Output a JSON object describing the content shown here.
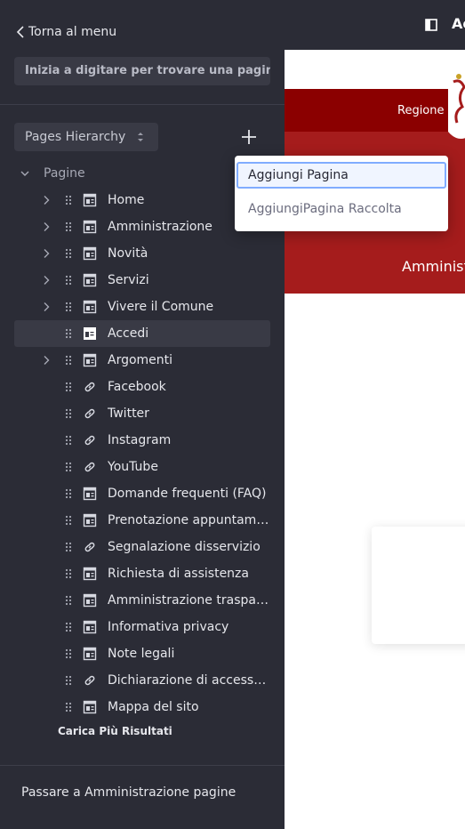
{
  "sidebar": {
    "back_label": "Torna al menu",
    "search_placeholder": "Inizia a digitare per trovare una pagina.",
    "hierarchy_select": "Pages Hierarchy",
    "root_label": "Pagine",
    "items": [
      {
        "label": "Home",
        "icon": "page-icon",
        "expandable": true
      },
      {
        "label": "Amministrazione",
        "icon": "page-icon",
        "expandable": true
      },
      {
        "label": "Novità",
        "icon": "page-icon",
        "expandable": true
      },
      {
        "label": "Servizi",
        "icon": "page-icon",
        "expandable": true
      },
      {
        "label": "Vivere il Comune",
        "icon": "page-icon",
        "expandable": true
      },
      {
        "label": "Accedi",
        "icon": "page-icon",
        "expandable": false,
        "selected": true
      },
      {
        "label": "Argomenti",
        "icon": "page-icon",
        "expandable": true
      },
      {
        "label": "Facebook",
        "icon": "link-icon",
        "expandable": false
      },
      {
        "label": "Twitter",
        "icon": "link-icon",
        "expandable": false
      },
      {
        "label": "Instagram",
        "icon": "link-icon",
        "expandable": false
      },
      {
        "label": "YouTube",
        "icon": "link-icon",
        "expandable": false
      },
      {
        "label": "Domande frequenti (FAQ)",
        "icon": "page-icon",
        "expandable": false
      },
      {
        "label": "Prenotazione appuntamento",
        "icon": "page-icon",
        "expandable": false
      },
      {
        "label": "Segnalazione disservizio",
        "icon": "link-icon",
        "expandable": false
      },
      {
        "label": "Richiesta di assistenza",
        "icon": "page-icon",
        "expandable": false
      },
      {
        "label": "Amministrazione trasparente",
        "icon": "page-icon",
        "expandable": false
      },
      {
        "label": "Informativa privacy",
        "icon": "page-icon",
        "expandable": false
      },
      {
        "label": "Note legali",
        "icon": "page-icon",
        "expandable": false
      },
      {
        "label": "Dichiarazione di accessibilità",
        "icon": "link-icon",
        "expandable": false
      },
      {
        "label": "Mappa del sito",
        "icon": "page-icon",
        "expandable": false
      }
    ],
    "load_more": "Carica Più Risultati",
    "footer_link": "Passare a Amministrazione pagine"
  },
  "dropdown": {
    "items": [
      "Aggiungi Pagina",
      "AggiungiPagina Raccolta"
    ]
  },
  "topbar": {
    "title": "Ac"
  },
  "preview": {
    "region_text": "Regione Marc",
    "band_text": "Amminist"
  },
  "colors": {
    "sidebar_bg": "#2b2c36",
    "input_bg": "#393a45",
    "dark_red": "#8b0000",
    "red": "#a51c1c",
    "focus_border": "#80acff"
  }
}
